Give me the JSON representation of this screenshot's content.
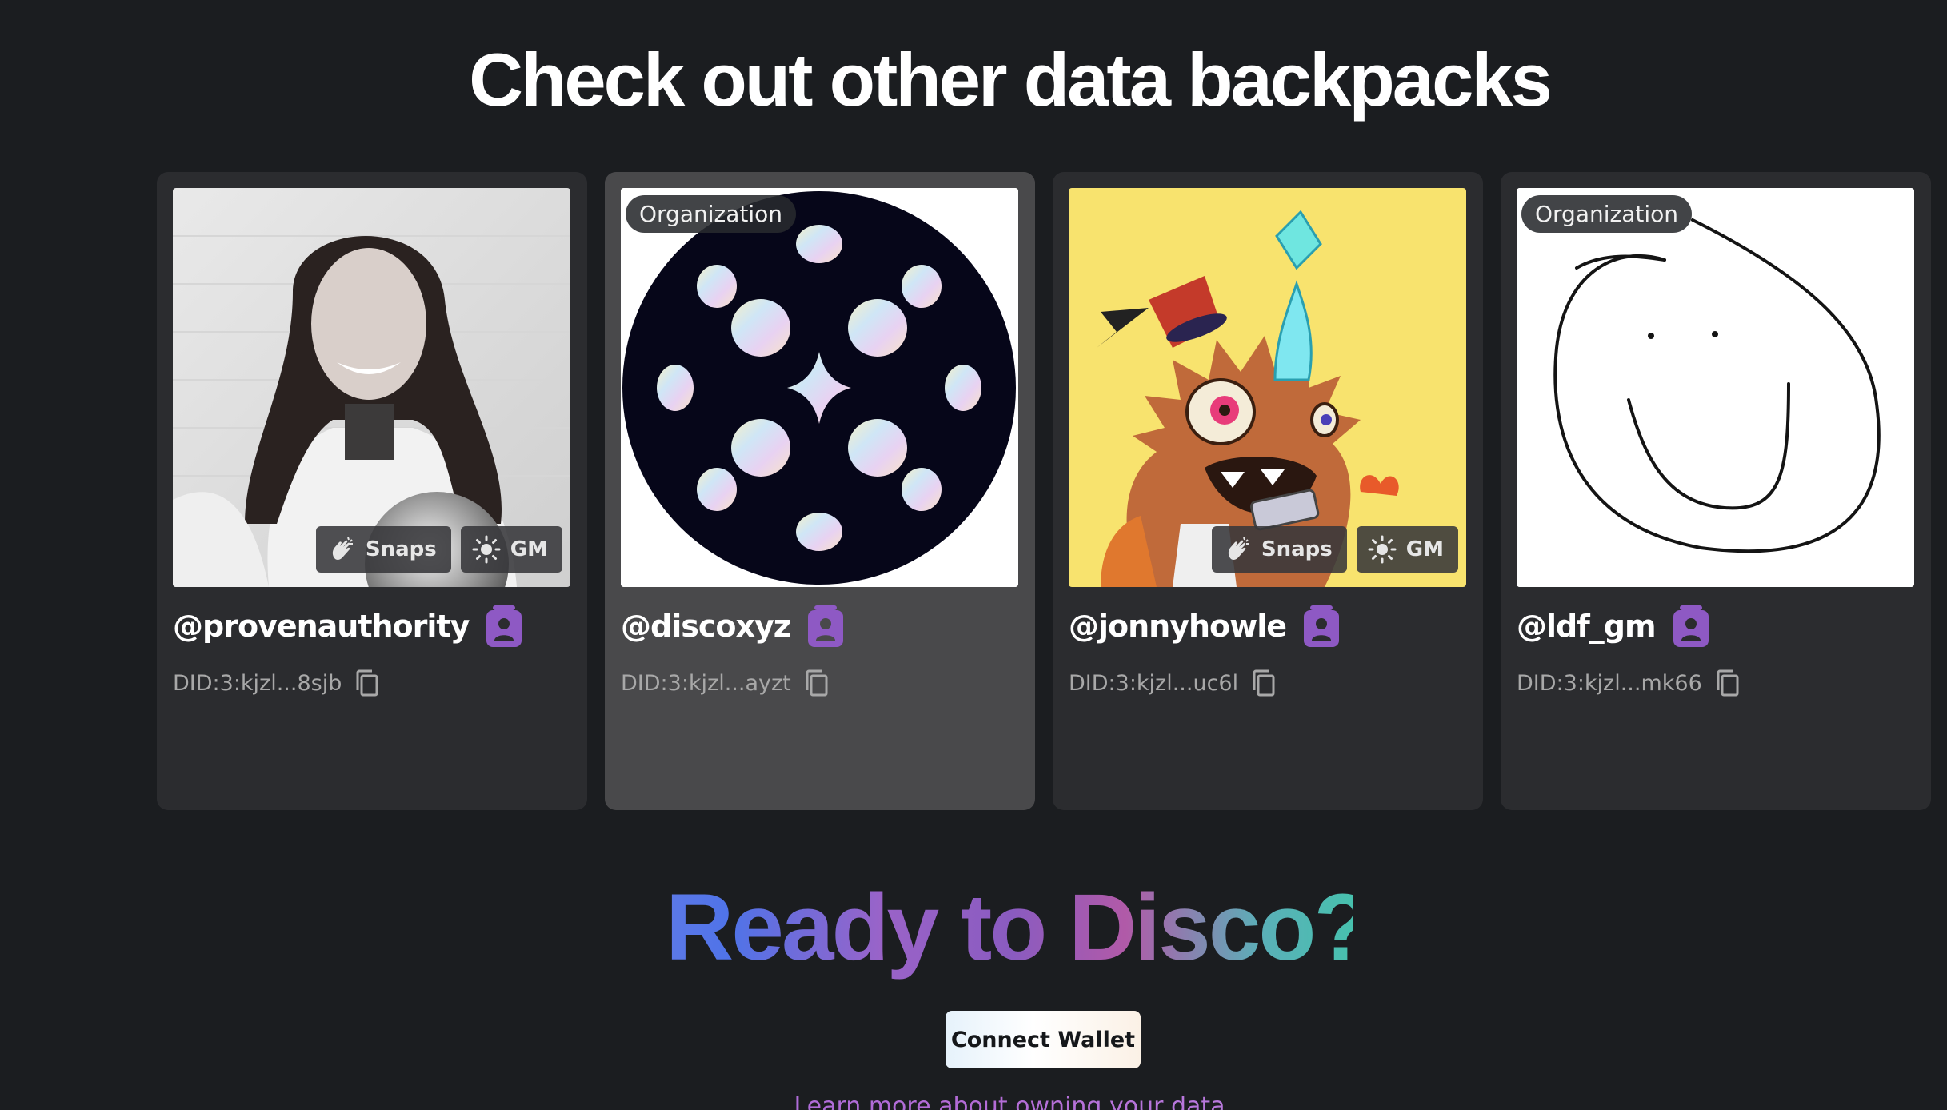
{
  "section": {
    "heading": "Check out other data backpacks"
  },
  "cards": [
    {
      "image_alt": "portrait-photo",
      "org_label": "",
      "handle": "@provenauthority",
      "did": "DID:3:kjzl...8sjb",
      "chips": [
        {
          "icon": "clap-icon",
          "label": "Snaps"
        },
        {
          "icon": "sun-icon",
          "label": "GM"
        }
      ]
    },
    {
      "image_alt": "disco-logo",
      "org_label": "Organization",
      "handle": "@discoxyz",
      "did": "DID:3:kjzl...ayzt",
      "chips": []
    },
    {
      "image_alt": "cartoon-creature",
      "org_label": "",
      "handle": "@jonnyhowle",
      "did": "DID:3:kjzl...uc6l",
      "chips": [
        {
          "icon": "clap-icon",
          "label": "Snaps"
        },
        {
          "icon": "sun-icon",
          "label": "GM"
        }
      ]
    },
    {
      "image_alt": "smiley-drawing",
      "org_label": "Organization",
      "handle": "@ldf_gm",
      "did": "DID:3:kjzl...mk66",
      "chips": []
    }
  ],
  "cta": {
    "title": "Ready to Disco?",
    "button_label": "Connect Wallet",
    "link_text": "Learn more about owning your data"
  },
  "colors": {
    "background": "#1b1d20",
    "card": "#2b2c2f",
    "card_active": "#49494b",
    "badge_purple": "#8e59c4"
  }
}
